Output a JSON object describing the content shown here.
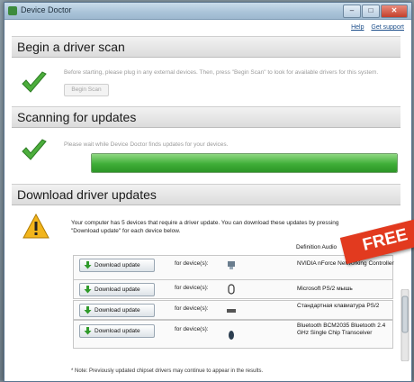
{
  "window": {
    "title": "Device Doctor"
  },
  "top_links": {
    "help": "Help",
    "support": "Get support"
  },
  "sections": {
    "begin": {
      "heading": "Begin a driver scan",
      "text": "Before starting, please plug in any external devices. Then, press \"Begin Scan\" to look for available drivers for this system.",
      "button": "Begin Scan"
    },
    "scanning": {
      "heading": "Scanning for updates",
      "text": "Please wait while Device Doctor finds updates for your devices.",
      "progress": 1.0
    },
    "download": {
      "heading": "Download driver updates",
      "intro": "Your computer has 5 devices that require a driver update. You can download these updates by pressing \"Download update\" for each device below.",
      "top_device": "Definition Audio",
      "rows": [
        {
          "button": "Download update",
          "for_label": "for device(s):",
          "icon": "network-icon",
          "device": "NVIDIA nForce Networking Controller"
        },
        {
          "button": "Download update",
          "for_label": "for device(s):",
          "icon": "mouse-icon",
          "device": "Microsoft PS/2 мышь"
        },
        {
          "button": "Download update",
          "for_label": "for device(s):",
          "icon": "keyboard-icon",
          "device": "Стандартная клавиатура PS/2"
        },
        {
          "button": "Download update",
          "for_label": "for device(s):",
          "icon": "bluetooth-icon",
          "device": "Bluetooth BCM2035 Bluetooth 2.4 GHz Single Chip Transceiver"
        }
      ],
      "note": "* Note: Previously updated chipset drivers may continue to appear in the results."
    }
  },
  "badge": {
    "free": "FREE"
  },
  "colors": {
    "accent_green": "#3fae38",
    "badge_red": "#e23a1f"
  }
}
